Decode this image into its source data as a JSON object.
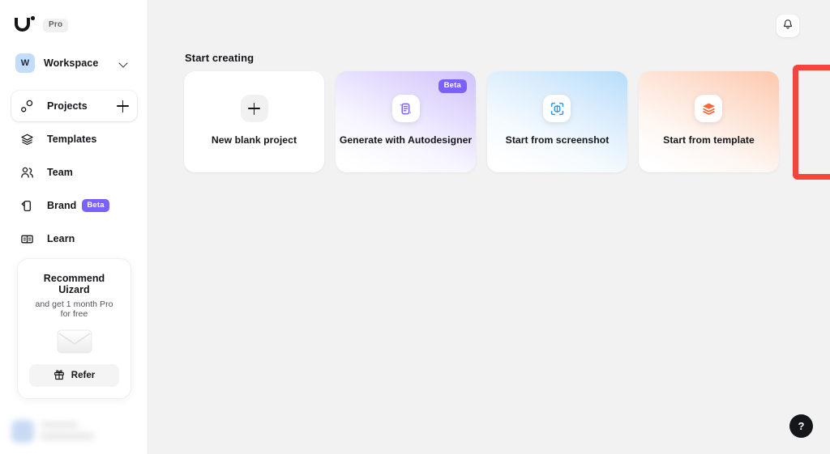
{
  "sidebar": {
    "logo_name": "uizard-logo",
    "plan_badge": "Pro",
    "workspace": {
      "avatar_initial": "W",
      "name": "Workspace",
      "chevron": "chevron-down-icon"
    },
    "nav_items": [
      {
        "id": "projects",
        "label": "Projects",
        "icon": "projects-icon",
        "selected": true,
        "has_add": true,
        "badge": ""
      },
      {
        "id": "templates",
        "label": "Templates",
        "icon": "templates-icon",
        "selected": false,
        "has_add": false,
        "badge": ""
      },
      {
        "id": "team",
        "label": "Team",
        "icon": "team-icon",
        "selected": false,
        "has_add": false,
        "badge": ""
      },
      {
        "id": "brand",
        "label": "Brand",
        "icon": "brand-icon",
        "selected": false,
        "has_add": false,
        "badge": "Beta"
      },
      {
        "id": "learn",
        "label": "Learn",
        "icon": "learn-icon",
        "selected": false,
        "has_add": false,
        "badge": ""
      }
    ],
    "refer_card": {
      "title": "Recommend Uizard",
      "subtitle": "and get 1 month Pro for free",
      "illustration": "envelope-illustration",
      "button_label": "Refer",
      "button_icon": "gift-icon"
    },
    "profile": {
      "state": "blurred"
    }
  },
  "header": {
    "notification_icon": "bell-icon"
  },
  "main": {
    "section_title": "Start creating",
    "cards": [
      {
        "id": "new-blank-project",
        "label": "New blank project",
        "icon": "plus-icon",
        "badge": "",
        "style": "blank"
      },
      {
        "id": "generate-with-autodesigner",
        "label": "Generate with Autodesigner",
        "icon": "autodesigner-icon",
        "badge": "Beta",
        "style": "autodesign"
      },
      {
        "id": "start-from-screenshot",
        "label": "Start from screenshot",
        "icon": "scan-icon",
        "badge": "",
        "style": "screenshot"
      },
      {
        "id": "start-from-template",
        "label": "Start from template",
        "icon": "layers-icon",
        "badge": "",
        "style": "template"
      }
    ],
    "highlighted_card": "start-from-template",
    "help_button_label": "?"
  },
  "colors": {
    "accent_purple": "#7b61f8",
    "accent_blue": "#2e9bf0",
    "accent_orange": "#f4683c",
    "highlight_red": "#f4453c",
    "sidebar_bg": "#ffffff",
    "canvas_bg": "#f2f2f2",
    "text_primary": "#14161a"
  }
}
